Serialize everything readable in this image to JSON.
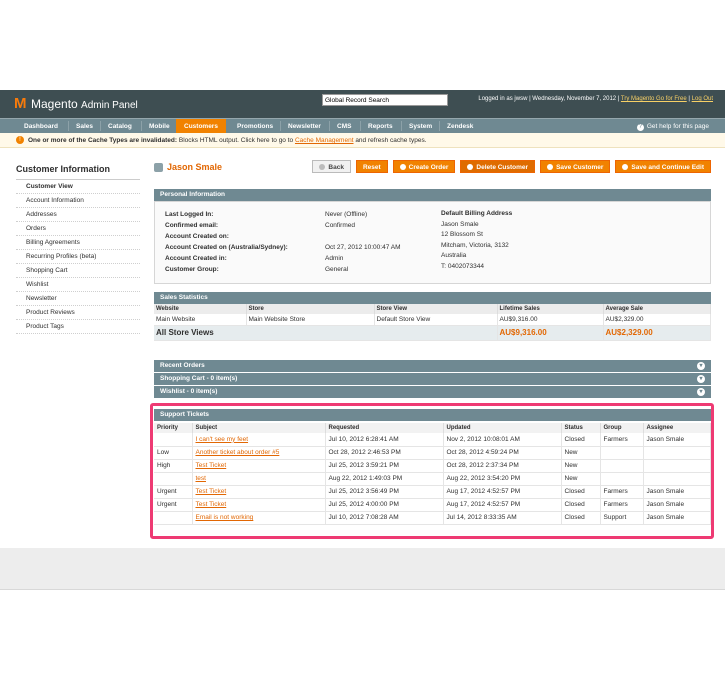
{
  "header": {
    "logo_brand": "Magento",
    "logo_sub": "Admin Panel",
    "search_value": "Global Record Search",
    "logged_in": "Logged in as jwsw  |  Wednesday, November 7, 2012  |",
    "try_link": "Try Magento Go for Free",
    "logout_link": "Log Out"
  },
  "nav": {
    "items": [
      "Dashboard",
      "Sales",
      "Catalog",
      "Mobile",
      "Customers",
      "Promotions",
      "Newsletter",
      "CMS",
      "Reports",
      "System",
      "Zendesk"
    ],
    "help": "Get help for this page"
  },
  "notice": {
    "bold": "One or more of the Cache Types are invalidated:",
    "text": " Blocks HTML output. Click here to go to",
    "link": "Cache Management",
    "tail": " and refresh cache types."
  },
  "sidebar": {
    "title": "Customer Information",
    "items": [
      "Customer View",
      "Account Information",
      "Addresses",
      "Orders",
      "Billing Agreements",
      "Recurring Profiles (beta)",
      "Shopping Cart",
      "Wishlist",
      "Newsletter",
      "Product Reviews",
      "Product Tags"
    ]
  },
  "page": {
    "title": "Jason Smale",
    "buttons": [
      "Back",
      "Reset",
      "Create Order",
      "Delete Customer",
      "Save Customer",
      "Save and Continue Edit"
    ]
  },
  "personal": {
    "heading": "Personal Information",
    "labels": [
      "Last Logged In:",
      "Confirmed email:",
      "Account Created on:",
      "Account Created on (Australia/Sydney):",
      "Account Created in:",
      "Customer Group:"
    ],
    "values": [
      "Never (Offline)",
      "Confirmed",
      "",
      "Oct 27, 2012 10:00:47 AM",
      "Admin",
      "General"
    ],
    "billing_title": "Default Billing Address",
    "billing_lines": [
      "Jason Smale",
      "12 Blossom St",
      "Mitcham, Victoria, 3132",
      "Australia",
      "T: 0402073344"
    ]
  },
  "sales": {
    "heading": "Sales Statistics",
    "columns": [
      "Website",
      "Store",
      "Store View",
      "Lifetime Sales",
      "Average Sale"
    ],
    "row": [
      "Main Website",
      "Main Website Store",
      "Default Store View",
      "AU$9,316.00",
      "AU$2,329.00"
    ],
    "total_label": "All Store Views",
    "total_lifetime": "AU$9,316.00",
    "total_average": "AU$2,329.00"
  },
  "collapsibles": [
    "Recent Orders",
    "Shopping Cart - 0 item(s)",
    "Wishlist - 0 item(s)"
  ],
  "tickets": {
    "heading": "Support Tickets",
    "columns": [
      "Priority",
      "Subject",
      "Requested",
      "Updated",
      "Status",
      "Group",
      "Assignee"
    ],
    "rows": [
      [
        "",
        "I can't see my feet",
        "Jul 10, 2012 6:28:41 AM",
        "Nov 2, 2012 10:08:01 AM",
        "Closed",
        "Farmers",
        "Jason Smale"
      ],
      [
        "Low",
        "Another ticket about order #5",
        "Oct 28, 2012 2:46:53 PM",
        "Oct 28, 2012 4:59:24 PM",
        "New",
        "",
        ""
      ],
      [
        "High",
        "Test Ticket",
        "Jul 25, 2012 3:59:21 PM",
        "Oct 28, 2012 2:37:34 PM",
        "New",
        "",
        ""
      ],
      [
        "",
        "test",
        "Aug 22, 2012 1:49:03 PM",
        "Aug 22, 2012 3:54:20 PM",
        "New",
        "",
        ""
      ],
      [
        "Urgent",
        "Test Ticket",
        "Jul 25, 2012 3:56:49 PM",
        "Aug 17, 2012 4:52:57 PM",
        "Closed",
        "Farmers",
        "Jason Smale"
      ],
      [
        "Urgent",
        "Test Ticket",
        "Jul 25, 2012 4:00:00 PM",
        "Aug 17, 2012 4:52:57 PM",
        "Closed",
        "Farmers",
        "Jason Smale"
      ],
      [
        "",
        "Email is not working",
        "Jul 10, 2012 7:08:28 AM",
        "Jul 14, 2012 8:33:35 AM",
        "Closed",
        "Support",
        "Jason Smale"
      ]
    ]
  },
  "colors": {
    "accent": "#f18200",
    "nav": "#6f8992",
    "header": "#3e4e52",
    "highlight": "#ee3a73"
  },
  "icons": [
    "magento-logo-icon",
    "user-icon",
    "warning-icon",
    "help-icon",
    "expand-icon"
  ]
}
